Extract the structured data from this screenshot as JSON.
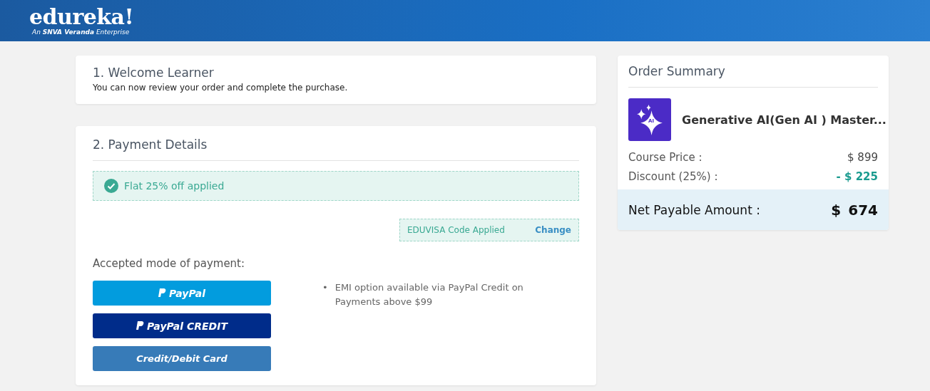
{
  "header": {
    "logo": "edureka!",
    "tagline_prefix": "An ",
    "tagline_brand": "SNVA Veranda",
    "tagline_suffix": " Enterprise"
  },
  "welcome": {
    "title": "1. Welcome Learner",
    "text": "You can now review your order and complete the purchase."
  },
  "payment": {
    "title": "2. Payment Details",
    "offer": "Flat 25% off applied",
    "coupon": {
      "text": "EDUVISA Code Applied",
      "action": "Change"
    },
    "modes_label": "Accepted mode of payment:",
    "methods": [
      {
        "kind": "paypal",
        "label": "PayPal"
      },
      {
        "kind": "paypal_credit",
        "label": "PayPal CREDIT"
      },
      {
        "kind": "card",
        "label": "Credit/Debit Card"
      }
    ],
    "notes": [
      {
        "bullet": "•",
        "text": "EMI option available via PayPal Credit on Payments above $99"
      }
    ]
  },
  "summary": {
    "title": "Order Summary",
    "course": {
      "icon_text": "AI",
      "name": "Generative AI(Gen AI ) Master..."
    },
    "lines": [
      {
        "kind": "plain",
        "label": "Course Price :",
        "value": "$ 899"
      },
      {
        "kind": "discount",
        "label": "Discount (25%) :",
        "value": "- $ 225"
      }
    ],
    "total": {
      "label": "Net Payable Amount :",
      "currency": "$",
      "amount": "674"
    }
  }
}
